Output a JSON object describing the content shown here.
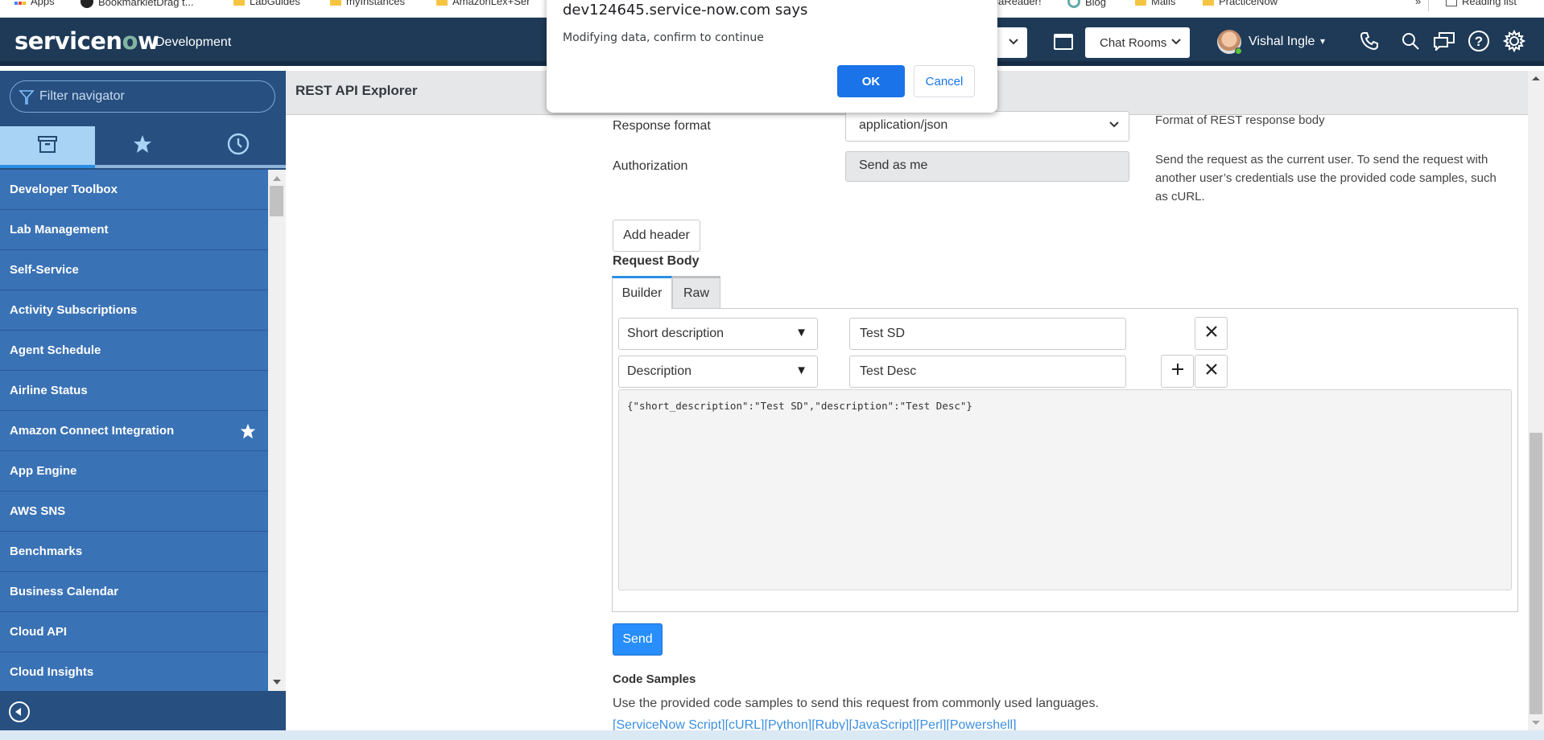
{
  "browser": {
    "bookmarks": [
      {
        "label": "Apps",
        "icon": "apps-grid-icon"
      },
      {
        "label": "BookmarkletDrag t...",
        "icon": "bookmarklet-icon"
      },
      {
        "label": "LabGuides",
        "icon": "folder-icon"
      },
      {
        "label": "myInstances",
        "icon": "folder-icon"
      },
      {
        "label": "AmazonLex+Ser",
        "icon": "folder-icon"
      },
      {
        "label": "elaReader!",
        "icon": "bookmark-icon"
      },
      {
        "label": "Blog",
        "icon": "blog-icon"
      },
      {
        "label": "Mails",
        "icon": "folder-icon"
      },
      {
        "label": "PracticeNow",
        "icon": "folder-icon"
      }
    ],
    "overflow": "»",
    "reading_list": "Reading list"
  },
  "header": {
    "logo": {
      "pre": "servicen",
      "o": "o",
      "post": "w"
    },
    "instance": "Development",
    "hidden_select_chev": "⌄",
    "chat_select": "Chat Rooms",
    "user_name": "Vishal Ingle",
    "user_caret": "▾"
  },
  "sidebar": {
    "filter_placeholder": "Filter navigator",
    "tabs": [
      {
        "name": "all-applications",
        "icon": "archive-box-icon",
        "active": true
      },
      {
        "name": "favorites",
        "icon": "star-icon",
        "active": false
      },
      {
        "name": "history",
        "icon": "clock-icon",
        "active": false
      }
    ],
    "items": [
      {
        "label": "Developer Toolbox",
        "favorite": false
      },
      {
        "label": "Lab Management",
        "favorite": false
      },
      {
        "label": "Self-Service",
        "favorite": false
      },
      {
        "label": "Activity Subscriptions",
        "favorite": false
      },
      {
        "label": "Agent Schedule",
        "favorite": false
      },
      {
        "label": "Airline Status",
        "favorite": false
      },
      {
        "label": "Amazon Connect Integration",
        "favorite": true
      },
      {
        "label": "App Engine",
        "favorite": false
      },
      {
        "label": "AWS SNS",
        "favorite": false
      },
      {
        "label": "Benchmarks",
        "favorite": false
      },
      {
        "label": "Business Calendar",
        "favorite": false
      },
      {
        "label": "Cloud API",
        "favorite": false
      },
      {
        "label": "Cloud Insights",
        "favorite": false
      }
    ]
  },
  "main": {
    "title": "REST API Explorer",
    "response_format": {
      "label": "Response format",
      "value": "application/json",
      "help": "Format of REST response body"
    },
    "authorization": {
      "label": "Authorization",
      "value": "Send as me",
      "help": "Send the request as the current user. To send the request with another user’s credentials use the provided code samples, such as cURL."
    },
    "add_header_label": "Add header",
    "request_body": {
      "heading": "Request Body",
      "tabs": [
        {
          "label": "Builder",
          "active": true
        },
        {
          "label": "Raw",
          "active": false
        }
      ],
      "fields": [
        {
          "field": "Short description",
          "value": "Test SD"
        },
        {
          "field": "Description",
          "value": "Test Desc"
        }
      ],
      "dropdown_glyph": "▼",
      "add_glyph": "+",
      "remove_glyph": "✕",
      "json_preview": "{\"short_description\":\"Test SD\",\"description\":\"Test Desc\"}"
    },
    "send_label": "Send",
    "code_samples": {
      "heading": "Code Samples",
      "description": "Use the provided code samples to send this request from commonly used languages.",
      "links": [
        "[ServiceNow Script]",
        "[cURL]",
        "[Python]",
        "[Ruby]",
        "[JavaScript]",
        "[Perl]",
        "[Powershell]"
      ]
    }
  },
  "dialog": {
    "title": "dev124645.service-now.com says",
    "message": "Modifying data, confirm to continue",
    "ok_label": "OK",
    "cancel_label": "Cancel"
  },
  "colors": {
    "header_bg": "#1e3a57",
    "sidebar_bg": "#274f80",
    "menu_item_bg": "#3a72b6",
    "accent_blue": "#278efc",
    "dialog_ok": "#1a73e8",
    "link": "#3b8fe0"
  }
}
